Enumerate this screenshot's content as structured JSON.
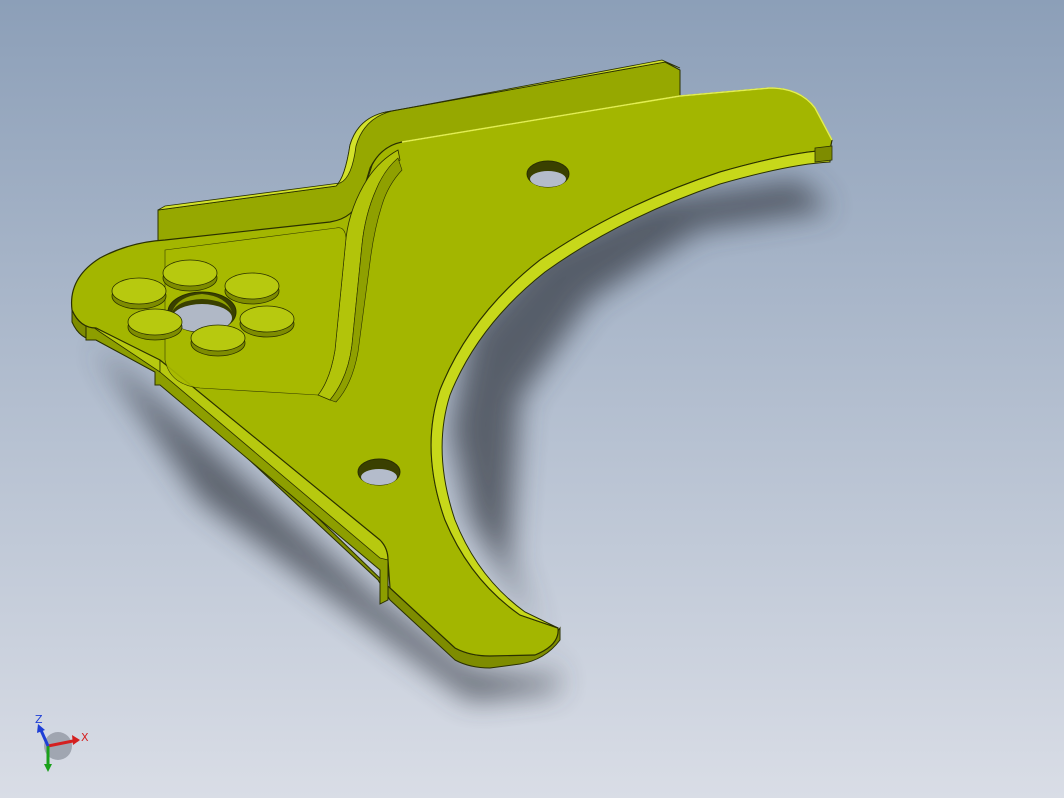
{
  "viewport": {
    "background_top": "#8c9fb8",
    "background_bottom": "#d9dde6"
  },
  "part": {
    "color_main": "#a0b400",
    "color_light": "#c8da1a",
    "color_dark": "#6e7c00",
    "color_edge": "#2a3000"
  },
  "triad": {
    "x_label": "X",
    "z_label": "Z",
    "x_color": "#d42020",
    "y_color": "#1aa01a",
    "z_color": "#1f3fd6"
  }
}
